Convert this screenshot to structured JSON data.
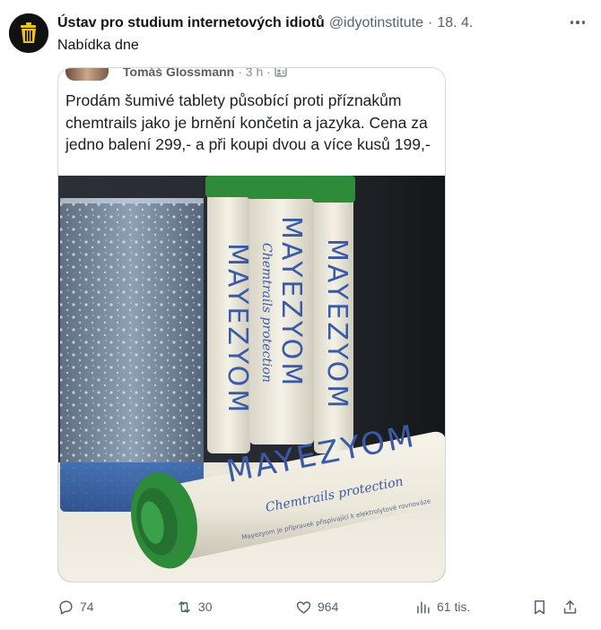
{
  "author": {
    "name": "Ústav pro studium internetových idiotů",
    "handle": "@idyotinstitute",
    "separator": "·",
    "date": "18. 4.",
    "avatar_icon": "trash-bin-icon"
  },
  "tweet": {
    "text": "Nabídka dne"
  },
  "embedded_post": {
    "author": "Tomáš Glossmann",
    "meta": "· 3 h ·",
    "audience_icon": "friends-icon",
    "text": "Prodám šumivé tablety působící proti příznakům chemtrails jako je brnění končetin a jazyka. Cena za jedno balení 299,- a při koupi dvou a více kusů 199,-"
  },
  "photo": {
    "brand": "MAYEZYOM",
    "subtitle": "Chemtrails protection",
    "small_print": "Mayezyom je přípravek přispívající k elektrolytové rovnováze"
  },
  "actions": {
    "replies": "74",
    "reposts": "30",
    "likes": "964",
    "views": "61 tis."
  },
  "colors": {
    "text_primary": "#0f1419",
    "text_secondary": "#536471",
    "border": "#cfd9de",
    "tube_cap": "#2e8b3a",
    "brand_text": "#3a5aa8"
  }
}
